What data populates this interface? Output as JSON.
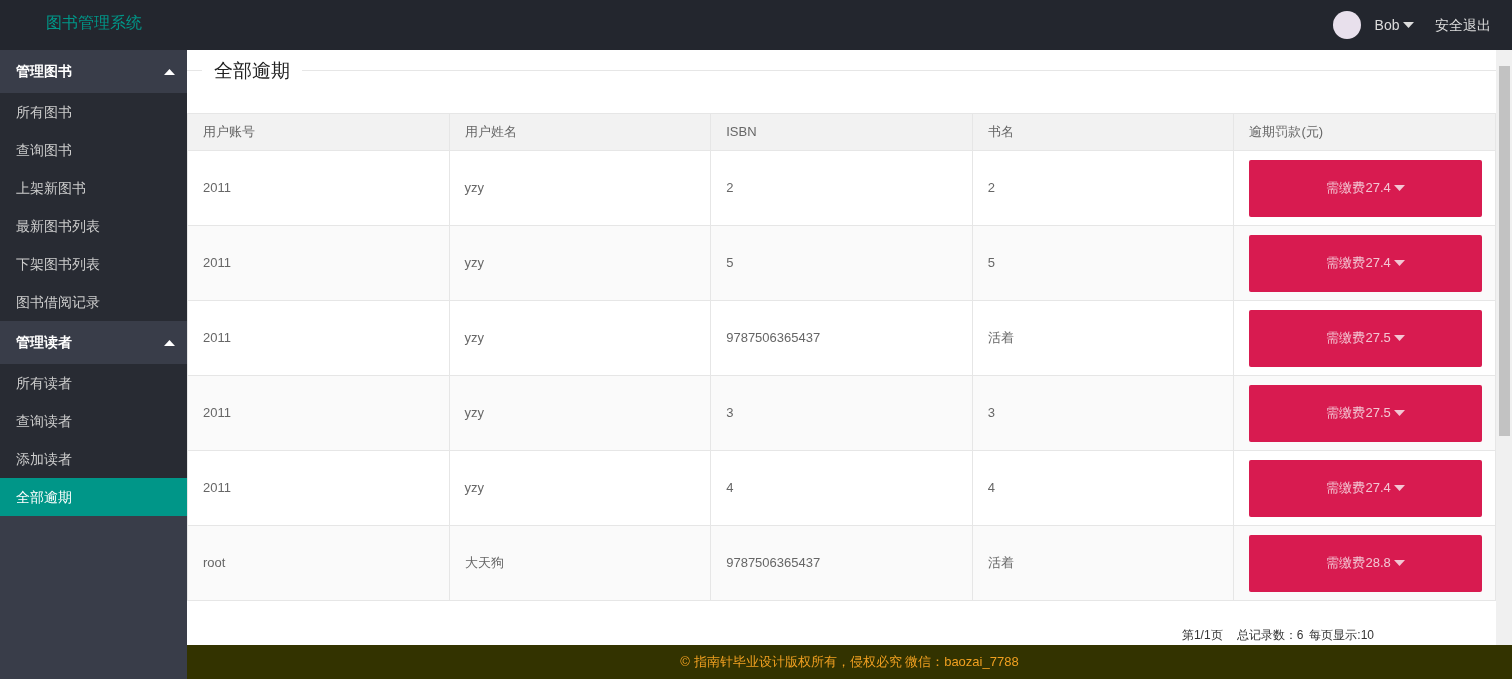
{
  "header": {
    "brand": "图书管理系统",
    "user": "Bob",
    "logout": "安全退出"
  },
  "sidebar": {
    "groups": [
      {
        "label": "管理图书",
        "expanded": true,
        "items": [
          {
            "label": "所有图书",
            "selected": false
          },
          {
            "label": "查询图书",
            "selected": false
          },
          {
            "label": "上架新图书",
            "selected": false
          },
          {
            "label": "最新图书列表",
            "selected": false
          },
          {
            "label": "下架图书列表",
            "selected": false
          },
          {
            "label": "图书借阅记录",
            "selected": false
          }
        ]
      },
      {
        "label": "管理读者",
        "expanded": true,
        "items": [
          {
            "label": "所有读者",
            "selected": false
          },
          {
            "label": "查询读者",
            "selected": false
          },
          {
            "label": "添加读者",
            "selected": false
          },
          {
            "label": "全部逾期",
            "selected": true
          }
        ]
      }
    ]
  },
  "page_title": "全部逾期",
  "table": {
    "columns": [
      "用户账号",
      "用户姓名",
      "ISBN",
      "书名",
      "逾期罚款(元)"
    ],
    "rows": [
      {
        "account": "2011",
        "name": "yzy",
        "isbn": "2",
        "title": "2",
        "fine": "需缴费27.4"
      },
      {
        "account": "2011",
        "name": "yzy",
        "isbn": "5",
        "title": "5",
        "fine": "需缴费27.4"
      },
      {
        "account": "2011",
        "name": "yzy",
        "isbn": "9787506365437",
        "title": "活着",
        "fine": "需缴费27.5"
      },
      {
        "account": "2011",
        "name": "yzy",
        "isbn": "3",
        "title": "3",
        "fine": "需缴费27.5"
      },
      {
        "account": "2011",
        "name": "yzy",
        "isbn": "4",
        "title": "4",
        "fine": "需缴费27.4"
      },
      {
        "account": "root",
        "name": "大天狗",
        "isbn": "9787506365437",
        "title": "活着",
        "fine": "需缴费28.8"
      }
    ]
  },
  "pagination": {
    "page": "第1/1页",
    "total": "总记录数：6",
    "per_page": "每页显示:10"
  },
  "footer": "© 指南针毕业设计版权所有，侵权必究 微信：baozai_7788"
}
